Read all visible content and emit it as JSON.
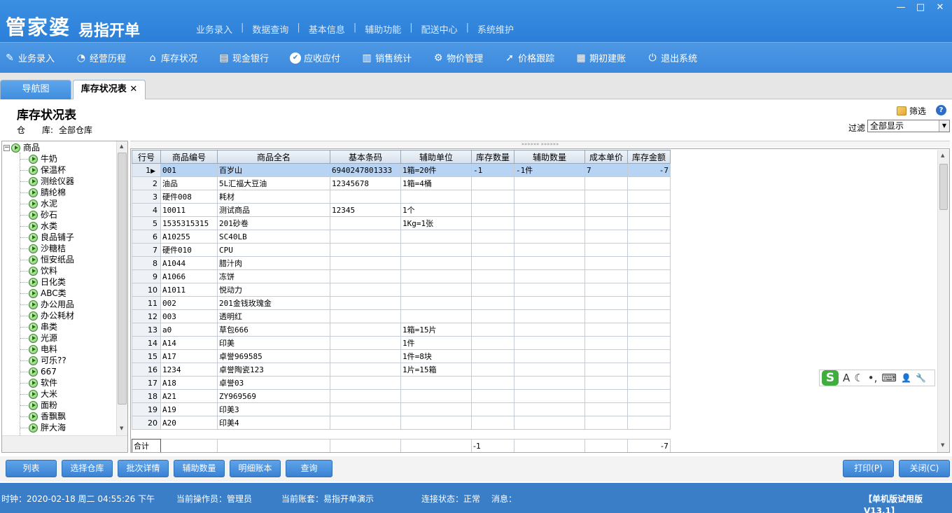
{
  "window": {
    "brand": "管家婆",
    "brand_sub": "易指开单",
    "top_menu": [
      "业务录入",
      "数据查询",
      "基本信息",
      "辅助功能",
      "配送中心",
      "系统维护"
    ],
    "controls": [
      "—",
      "□",
      "✕"
    ]
  },
  "toolbar": {
    "items": [
      {
        "label": "业务录入",
        "icon": "pen-icon"
      },
      {
        "label": "经营历程",
        "icon": "pie-chart-icon"
      },
      {
        "label": "库存状况",
        "icon": "home-icon"
      },
      {
        "label": "现金银行",
        "icon": "bank-icon"
      },
      {
        "label": "应收应付",
        "icon": "check-circle-icon"
      },
      {
        "label": "销售统计",
        "icon": "bar-chart-icon"
      },
      {
        "label": "物价管理",
        "icon": "gear-icon"
      },
      {
        "label": "价格跟踪",
        "icon": "arrow-icon"
      },
      {
        "label": "期初建账",
        "icon": "calculator-icon"
      },
      {
        "label": "退出系统",
        "icon": "power-icon"
      }
    ]
  },
  "tabs": [
    {
      "label": "导航图"
    },
    {
      "label": "库存状况表",
      "close": "✕"
    }
  ],
  "page": {
    "title": "库存状况表",
    "warehouse_label": "仓　　库:",
    "warehouse_value": "全部仓库",
    "filter_button": "筛选",
    "help": "?",
    "filter_label": "过滤",
    "filter_value": "全部显示"
  },
  "tree": {
    "root": "商品",
    "items": [
      "牛奶",
      "保温杯",
      "测绘仪器",
      "腈纶棉",
      "水泥",
      "砂石",
      "水类",
      "良品铺子",
      "沙糖桔",
      "恒安纸品",
      "饮料",
      "日化类",
      "ABC类",
      "办公用品",
      "办公耗材",
      "串类",
      "光源",
      "电料",
      "可乐??",
      "667",
      "软件",
      "大米",
      "面粉",
      "香飘飘",
      "胖大海"
    ]
  },
  "grid": {
    "columns": [
      "行号",
      "商品编号",
      "商品全名",
      "基本条码",
      "辅助单位",
      "库存数量",
      "辅助数量",
      "成本单价",
      "库存金额"
    ],
    "rows": [
      [
        "1",
        "001",
        "百岁山",
        "6940247801333",
        "1箱=20件",
        "-1",
        "-1件",
        "7",
        "-7"
      ],
      [
        "2",
        "油品",
        "5L汇福大豆油",
        "12345678",
        "1箱=4桶",
        "",
        "",
        "",
        ""
      ],
      [
        "3",
        "硬件008",
        "耗材",
        "",
        "",
        "",
        "",
        "",
        ""
      ],
      [
        "4",
        "10011",
        "测试商品",
        "12345",
        "1个",
        "",
        "",
        "",
        ""
      ],
      [
        "5",
        "1535315315",
        "201砂卷",
        "",
        "1Kg=1张",
        "",
        "",
        "",
        ""
      ],
      [
        "6",
        "A10255",
        "SC40LB",
        "",
        "",
        "",
        "",
        "",
        ""
      ],
      [
        "7",
        "硬件010",
        "CPU",
        "",
        "",
        "",
        "",
        "",
        ""
      ],
      [
        "8",
        "A1044",
        "腊汁肉",
        "",
        "",
        "",
        "",
        "",
        ""
      ],
      [
        "9",
        "A1066",
        "冻饼",
        "",
        "",
        "",
        "",
        "",
        ""
      ],
      [
        "10",
        "A1011",
        "悦动力",
        "",
        "",
        "",
        "",
        "",
        ""
      ],
      [
        "11",
        "002",
        "201金钱玫瑰金",
        "",
        "",
        "",
        "",
        "",
        ""
      ],
      [
        "12",
        "003",
        "透明红",
        "",
        "",
        "",
        "",
        "",
        ""
      ],
      [
        "13",
        "a0",
        "草包666",
        "",
        "1箱=15片",
        "",
        "",
        "",
        ""
      ],
      [
        "14",
        "A14",
        "印美",
        "",
        "1件",
        "",
        "",
        "",
        ""
      ],
      [
        "15",
        "A17",
        "卓誉969585",
        "",
        "1件=8块",
        "",
        "",
        "",
        ""
      ],
      [
        "16",
        "1234",
        "卓誉陶瓷123",
        "",
        "1片=15箱",
        "",
        "",
        "",
        ""
      ],
      [
        "17",
        "A18",
        "卓誉03",
        "",
        "",
        "",
        "",
        "",
        ""
      ],
      [
        "18",
        "A21",
        "ZY969569",
        "",
        "",
        "",
        "",
        "",
        ""
      ],
      [
        "19",
        "A19",
        "印美3",
        "",
        "",
        "",
        "",
        "",
        ""
      ],
      [
        "20",
        "A20",
        "印美4",
        "",
        "",
        "",
        "",
        "",
        ""
      ]
    ],
    "total_label": "合计",
    "total_qty": "-1",
    "total_amount": "-7"
  },
  "ime": {
    "logo": "S",
    "items": [
      "A",
      "☾",
      "•,",
      "⌨",
      "👤",
      "🔧"
    ]
  },
  "buttons": {
    "left": [
      "列表",
      "选择仓库",
      "批次详情",
      "辅助数量",
      "明细账本",
      "查询"
    ],
    "print": "打印(P)",
    "close": "关闭(C)"
  },
  "status": {
    "clock": "时钟：2020-02-18 周二 04:55:26 下午",
    "operator": "当前操作员：管理员",
    "account": "当前账套：易指开单演示",
    "connection": "连接状态：正常",
    "message": "消息：",
    "edition": "【单机版试用版V13.1】"
  },
  "colors": {
    "accent": "#3a82d2",
    "selected_row": "#b8d4f4",
    "status_bar": "#3a7ec8"
  }
}
